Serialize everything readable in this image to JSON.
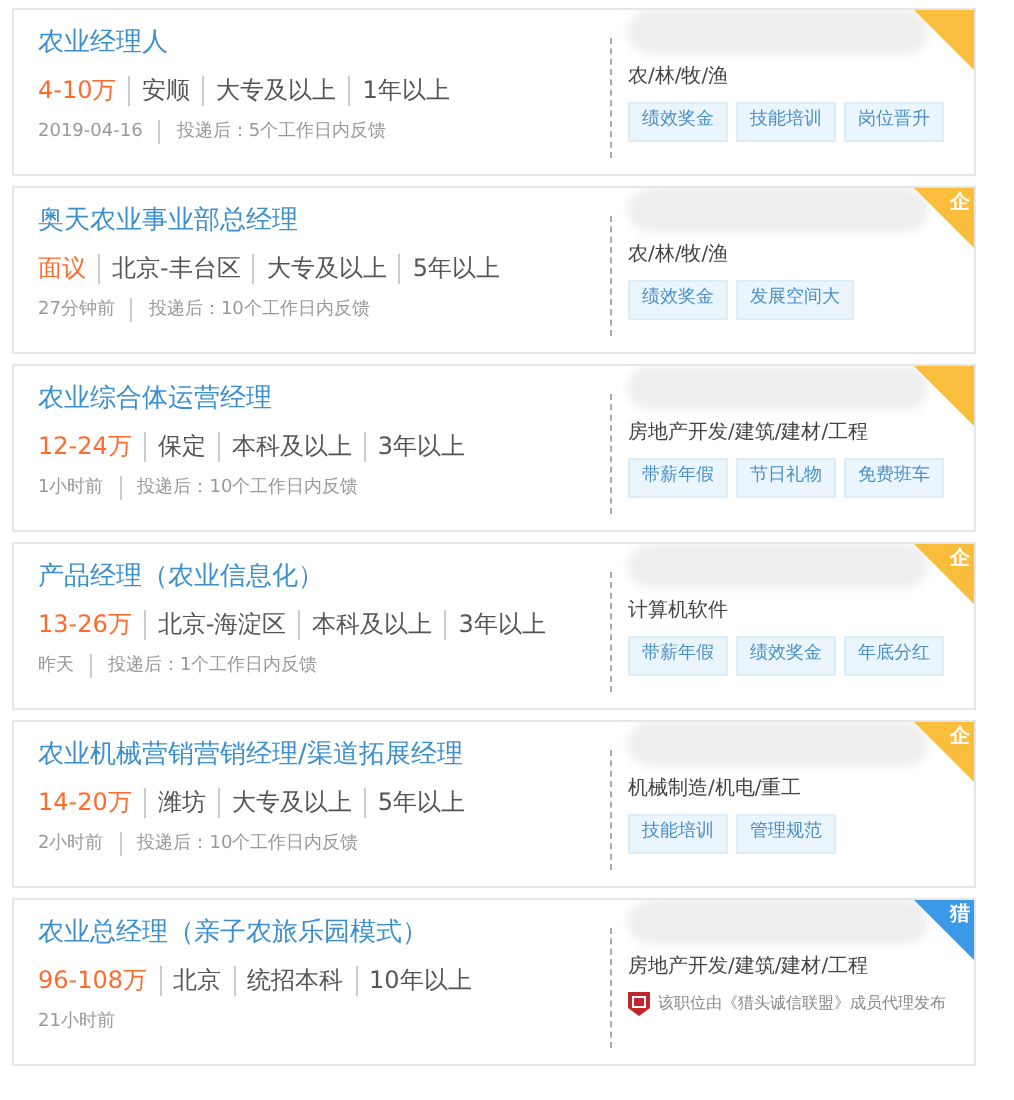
{
  "jobs": [
    {
      "title": "农业经理人",
      "salary": "4-10万",
      "details": [
        "安顺",
        "大专及以上",
        "1年以上"
      ],
      "posted": "2019-04-16",
      "feedback": "投递后：5个工作日内反馈",
      "industry": "农/林/牧/渔",
      "tags": [
        "绩效奖金",
        "技能培训",
        "岗位晋升"
      ],
      "badge": {
        "kind": "enterprise"
      }
    },
    {
      "title": "奥天农业事业部总经理",
      "salary": "面议",
      "details": [
        "北京-丰台区",
        "大专及以上",
        "5年以上"
      ],
      "posted": "27分钟前",
      "feedback": "投递后：10个工作日内反馈",
      "industry": "农/林/牧/渔",
      "tags": [
        "绩效奖金",
        "发展空间大"
      ],
      "badge": {
        "kind": "enterprise",
        "label": "企"
      }
    },
    {
      "title": "农业综合体运营经理",
      "salary": "12-24万",
      "details": [
        "保定",
        "本科及以上",
        "3年以上"
      ],
      "posted": "1小时前",
      "feedback": "投递后：10个工作日内反馈",
      "industry": "房地产开发/建筑/建材/工程",
      "tags": [
        "带薪年假",
        "节日礼物",
        "免费班车"
      ],
      "badge": {
        "kind": "enterprise"
      }
    },
    {
      "title": "产品经理（农业信息化）",
      "salary": "13-26万",
      "details": [
        "北京-海淀区",
        "本科及以上",
        "3年以上"
      ],
      "posted": "昨天",
      "feedback": "投递后：1个工作日内反馈",
      "industry": "计算机软件",
      "tags": [
        "带薪年假",
        "绩效奖金",
        "年底分红"
      ],
      "badge": {
        "kind": "enterprise",
        "label": "企"
      }
    },
    {
      "title": "农业机械营销营销经理/渠道拓展经理",
      "salary": "14-20万",
      "details": [
        "潍坊",
        "大专及以上",
        "5年以上"
      ],
      "posted": "2小时前",
      "feedback": "投递后：10个工作日内反馈",
      "industry": "机械制造/机电/重工",
      "tags": [
        "技能培训",
        "管理规范"
      ],
      "badge": {
        "kind": "enterprise",
        "label": "企"
      }
    },
    {
      "title": "农业总经理（亲子农旅乐园模式）",
      "salary": "96-108万",
      "details": [
        "北京",
        "统招本科",
        "10年以上"
      ],
      "posted": "21小时前",
      "industry": "房地产开发/建筑/建材/工程",
      "note": "该职位由《猎头诚信联盟》成员代理发布",
      "badge": {
        "kind": "headhunter",
        "label": "猎"
      }
    }
  ]
}
